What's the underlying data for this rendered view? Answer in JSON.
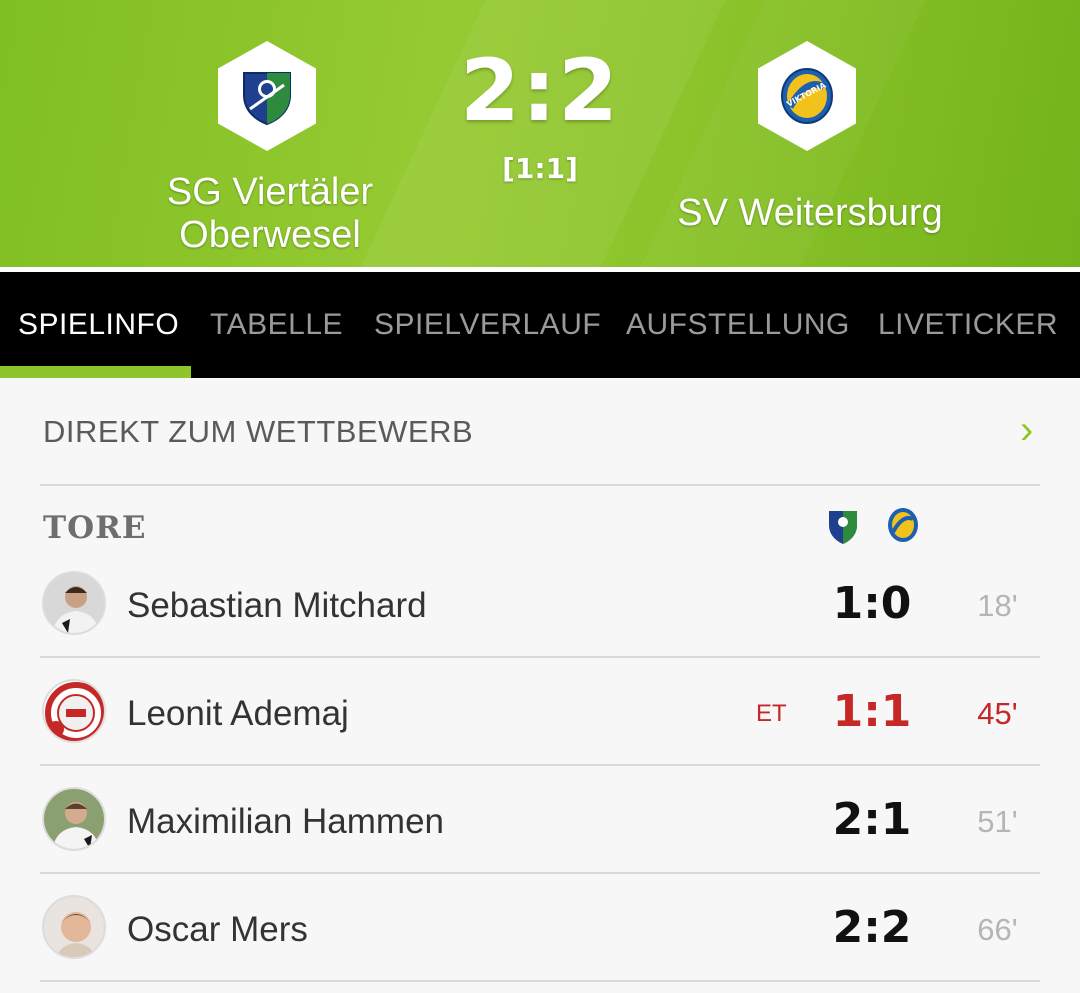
{
  "match": {
    "home_team": "SG Viertäler Oberwesel",
    "home_team_line1": "SG Viertäler",
    "home_team_line2": "Oberwesel",
    "away_team": "SV Weitersburg",
    "score": "2:2",
    "halftime": "[1:1]",
    "home_crest_icon": "club-crest-blue-green-icon",
    "away_crest_icon": "club-crest-viktoria-icon",
    "away_crest_text": "VIKTORIA"
  },
  "tabs": [
    {
      "label": "SPIELINFO",
      "active": true
    },
    {
      "label": "TABELLE",
      "active": false
    },
    {
      "label": "SPIELVERLAUF",
      "active": false
    },
    {
      "label": "AUFSTELLUNG",
      "active": false
    },
    {
      "label": "LIVETICKER",
      "active": false
    }
  ],
  "competition_link": {
    "label": "DIREKT ZUM WETTBEWERB",
    "icon": "chevron-right-icon"
  },
  "goals": {
    "title": "TORE",
    "items": [
      {
        "player": "Sebastian Mitchard",
        "score": "1:0",
        "minute": "18'",
        "own_goal": false,
        "own_goal_label": ""
      },
      {
        "player": "Leonit Ademaj",
        "score": "1:1",
        "minute": "45'",
        "own_goal": true,
        "own_goal_label": "ET"
      },
      {
        "player": "Maximilian Hammen",
        "score": "2:1",
        "minute": "51'",
        "own_goal": false,
        "own_goal_label": ""
      },
      {
        "player": "Oscar Mers",
        "score": "2:2",
        "minute": "66'",
        "own_goal": false,
        "own_goal_label": ""
      }
    ]
  },
  "colors": {
    "accent_green": "#8ec52c",
    "own_goal_red": "#c62828",
    "tabbar_bg": "#000000"
  }
}
